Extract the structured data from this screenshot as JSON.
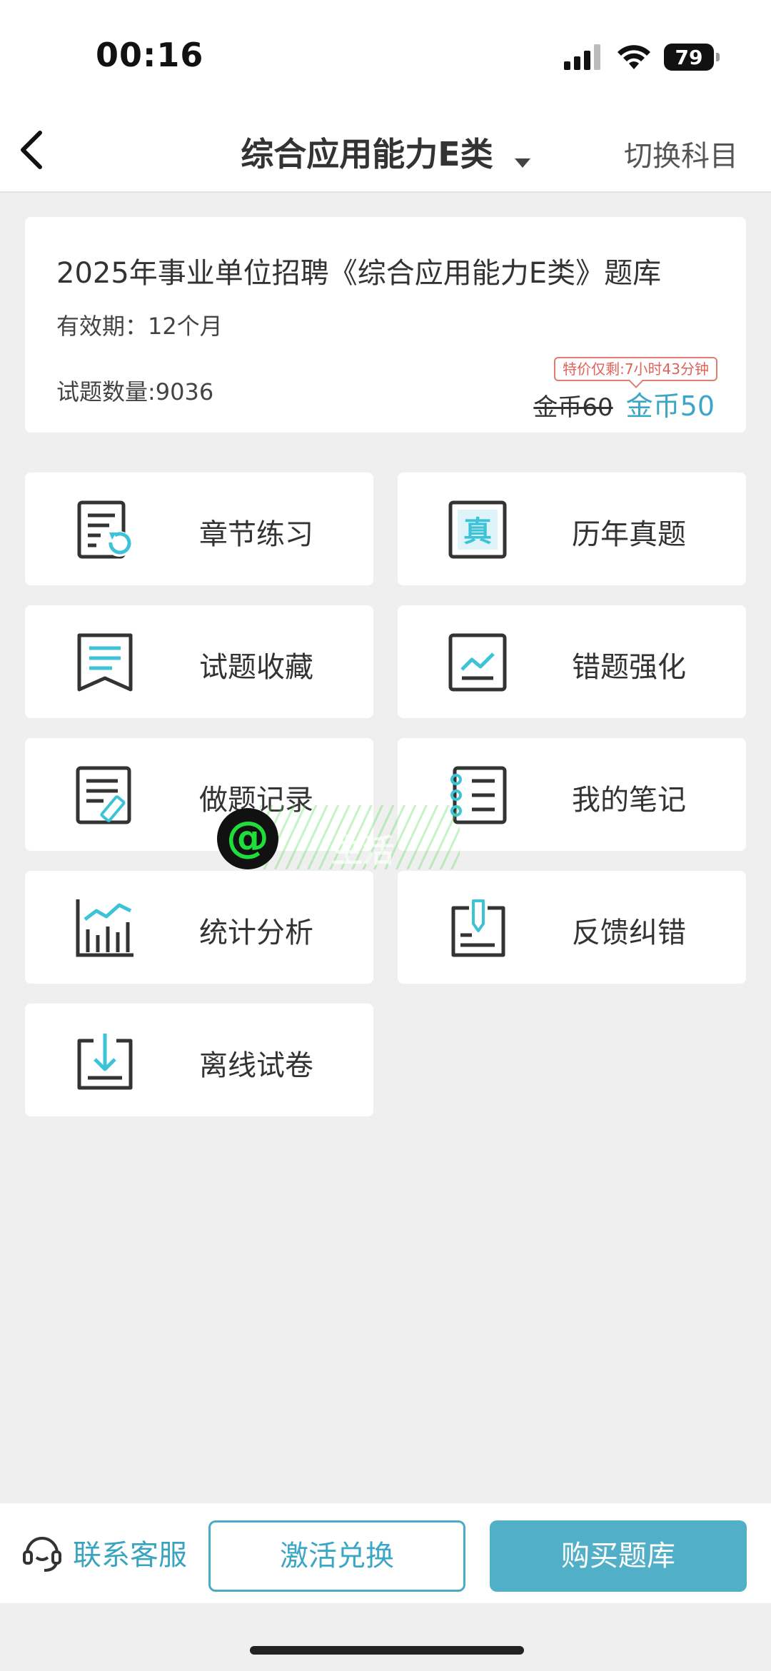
{
  "status": {
    "time": "00:16",
    "battery": "79"
  },
  "nav": {
    "title": "综合应用能力E类",
    "switch_label": "切换科目"
  },
  "info": {
    "title": "2025年事业单位招聘《综合应用能力E类》题库",
    "validity": "有效期：12个月",
    "count": "试题数量:9036",
    "promo": "特价仅剩:7小时43分钟",
    "old_price": "金币60",
    "new_price": "金币50"
  },
  "menu": [
    {
      "label": "章节练习",
      "icon": "chapter-practice-icon"
    },
    {
      "label": "历年真题",
      "icon": "past-exams-icon",
      "glyph": "真"
    },
    {
      "label": "试题收藏",
      "icon": "bookmark-icon"
    },
    {
      "label": "错题强化",
      "icon": "mistake-review-icon"
    },
    {
      "label": "做题记录",
      "icon": "record-edit-icon"
    },
    {
      "label": "我的笔记",
      "icon": "notebook-icon"
    },
    {
      "label": "统计分析",
      "icon": "bar-chart-icon"
    },
    {
      "label": "反馈纠错",
      "icon": "feedback-icon"
    },
    {
      "label": "离线试卷",
      "icon": "download-icon"
    }
  ],
  "watermark": {
    "text": "生活"
  },
  "bottom": {
    "support_label": "联系客服",
    "activate_label": "激活兑换",
    "buy_label": "购买题库"
  },
  "colors": {
    "accent": "#3ba6c6",
    "icon_dark": "#333333",
    "icon_accent": "#3dc3d8",
    "promo": "#e0625a"
  }
}
